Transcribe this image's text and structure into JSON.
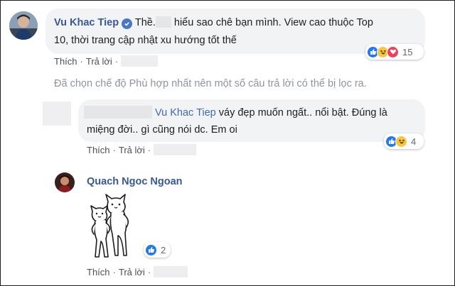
{
  "comment1": {
    "author": "Vu Khac Tiep",
    "line1_a": "Thề.",
    "line1_b": "hiểu sao chê bạn mình. View cao thuộc Top",
    "line2": "10, thời trang cập nhật xu hướng tốt thế",
    "like_label": "Thích",
    "reply_label": "Trả lời",
    "reaction_count": "15",
    "reactions": [
      "like-icon",
      "haha-icon",
      "love-icon"
    ]
  },
  "filter_note": "Đã chọn chế độ Phù hợp nhất nên một số câu trả lời có thể bị lọc ra.",
  "reply1": {
    "mention": "Vu Khac Tiep",
    "line1_rest": " váy đẹp muốn ngất.. nổi bật. Đúng là",
    "line2": "miệng đời.. gì cũng nói dc. Em oi",
    "like_label": "Thích",
    "reply_label": "Trả lời",
    "reaction_count": "4",
    "reactions": [
      "like-icon",
      "haha-icon"
    ]
  },
  "reply2": {
    "author": "Quach Ngoc Ngoan",
    "like_label": "Thích",
    "reply_label": "Trả lời",
    "reaction_count": "2",
    "reactions": [
      "like-icon"
    ]
  },
  "colors": {
    "name_blue": "#385898",
    "bubble_bg": "#f2f3f5",
    "like_blue": "#2078f4",
    "haha_yellow": "#f7c744",
    "love_red": "#f33e58",
    "muted_gray": "#90949c"
  }
}
